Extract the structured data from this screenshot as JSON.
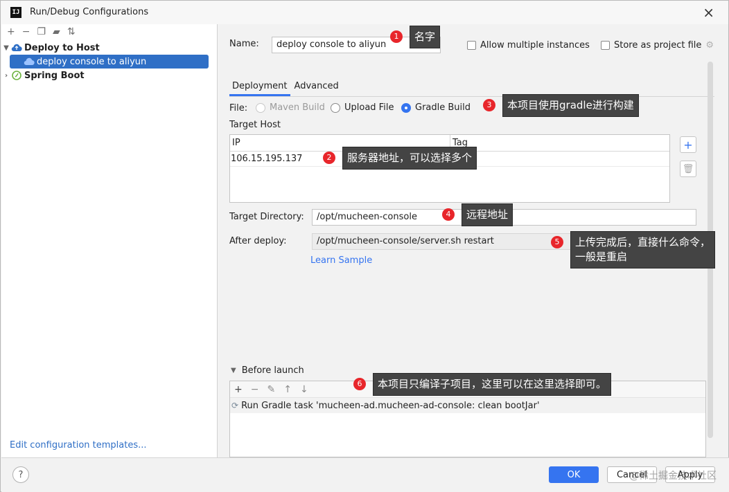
{
  "window": {
    "title": "Run/Debug Configurations",
    "logo": "IJ",
    "close_icon": "×"
  },
  "left": {
    "toolbar_icons": [
      "add-icon",
      "remove-icon",
      "copy-icon",
      "folder-icon",
      "sort-icon"
    ],
    "tree": [
      {
        "label": "Deploy to Host",
        "expanded": true
      },
      {
        "label": "deploy console to aliyun",
        "selected": true
      },
      {
        "label": "Spring Boot",
        "expanded": false
      }
    ],
    "edit_templates": "Edit configuration templates..."
  },
  "form": {
    "name_label": "Name:",
    "name_value": "deploy console to aliyun",
    "allow_multiple": "Allow multiple instances",
    "store_as_project": "Store as project file",
    "tabs": [
      "Deployment",
      "Advanced"
    ],
    "file_label": "File:",
    "file_options": [
      "Maven Build",
      "Upload File",
      "Gradle Build"
    ],
    "file_selected": "Gradle Build",
    "target_host_label": "Target Host",
    "host_headers": [
      "IP",
      "Tag"
    ],
    "host_rows": [
      {
        "ip": "106.15.195.137",
        "tag": ""
      }
    ],
    "target_dir_label": "Target Directory:",
    "target_dir_value": "/opt/mucheen-console",
    "after_deploy_label": "After deploy:",
    "after_deploy_value": "/opt/mucheen-console/server.sh restart",
    "learn_sample": "Learn Sample",
    "before_launch_label": "Before launch",
    "before_launch_task": "Run Gradle task 'mucheen-ad.mucheen-ad-console: clean bootJar'"
  },
  "buttons": {
    "ok": "OK",
    "cancel": "Cancel",
    "apply": "Apply",
    "help": "?"
  },
  "annotations": [
    {
      "n": "1",
      "text": "名字"
    },
    {
      "n": "2",
      "text": "服务器地址，可以选择多个"
    },
    {
      "n": "3",
      "text": "本项目使用gradle进行构建"
    },
    {
      "n": "4",
      "text": "远程地址"
    },
    {
      "n": "5",
      "text": "上传完成后，直接什么命令，",
      "text2": "一般是重启"
    },
    {
      "n": "6",
      "text": "本项目只编译子项目，这里可以在这里选择即可。"
    }
  ],
  "watermark": "@稀土掘金技术社区",
  "colors": {
    "accent": "#3574f0",
    "selection": "#2f6fc6",
    "badge": "#e8262b",
    "callout": "#444444"
  }
}
